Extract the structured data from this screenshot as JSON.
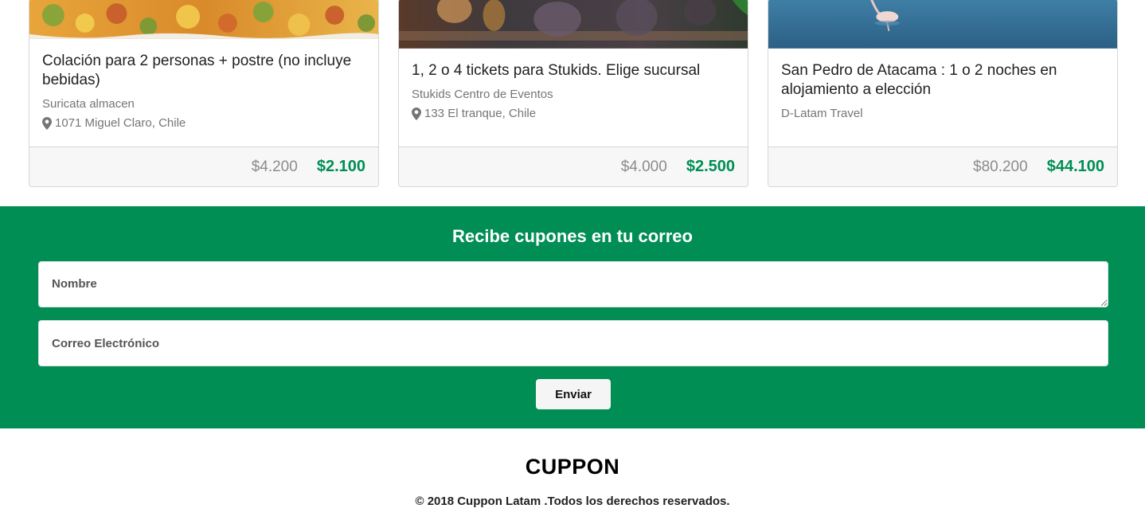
{
  "deals": [
    {
      "image_icon": "food-dish-photo",
      "title": "Colación para 2 personas + postre (no incluye bebidas)",
      "merchant": "Suricata almacen",
      "address": "1071 Miguel Claro, Chile",
      "old_price": "$4.200",
      "new_price": "$2.100"
    },
    {
      "image_icon": "crowd-event-photo",
      "title": "1, 2 o 4 tickets para Stukids. Elige sucursal",
      "merchant": "Stukids Centro de Eventos",
      "address": "133 El tranque, Chile",
      "old_price": "$4.000",
      "new_price": "$2.500"
    },
    {
      "image_icon": "flamingo-lake-photo",
      "title": "San Pedro de Atacama : 1 o 2 noches en alojamiento a elección",
      "merchant": "D-Latam Travel",
      "old_price": "$80.200",
      "new_price": "$44.100"
    }
  ],
  "newsletter": {
    "title": "Recibe cupones en tu correo",
    "name_placeholder": "Nombre",
    "email_placeholder": "Correo Electrónico",
    "submit_label": "Enviar"
  },
  "footer": {
    "brand": "CUPPON",
    "copyright": "© 2018 Cuppon Latam .Todos los derechos reservados."
  },
  "colors": {
    "accent_green": "#008e55",
    "price_green": "#008e55",
    "old_price_gray": "#8c8c8c"
  }
}
